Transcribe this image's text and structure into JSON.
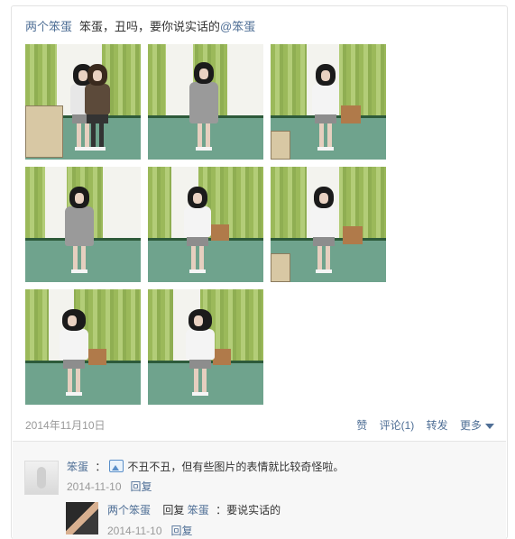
{
  "post": {
    "author": "两个笨蛋",
    "text": "笨蛋，丑吗，要你说实话的",
    "mention": "@笨蛋",
    "date": "2014年11月10日",
    "photo_count": 8
  },
  "actions": {
    "like": "赞",
    "comment": "评论(1)",
    "share": "转发",
    "more": "更多"
  },
  "comments": [
    {
      "name": "笨蛋",
      "separator": "：",
      "icon": "image-icon",
      "text": "不丑不丑，但有些图片的表情就比较奇怪啦。",
      "time": "2014-11-10",
      "reply_label": "回复"
    },
    {
      "name": "两个笨蛋",
      "reply_word": "回复",
      "target": "笨蛋",
      "separator": "：",
      "text": "要说实话的",
      "time": "2014-11-10",
      "reply_label": "回复"
    }
  ],
  "colors": {
    "link": "#4f6f96",
    "muted": "#999999",
    "border": "#e3e3e3"
  }
}
